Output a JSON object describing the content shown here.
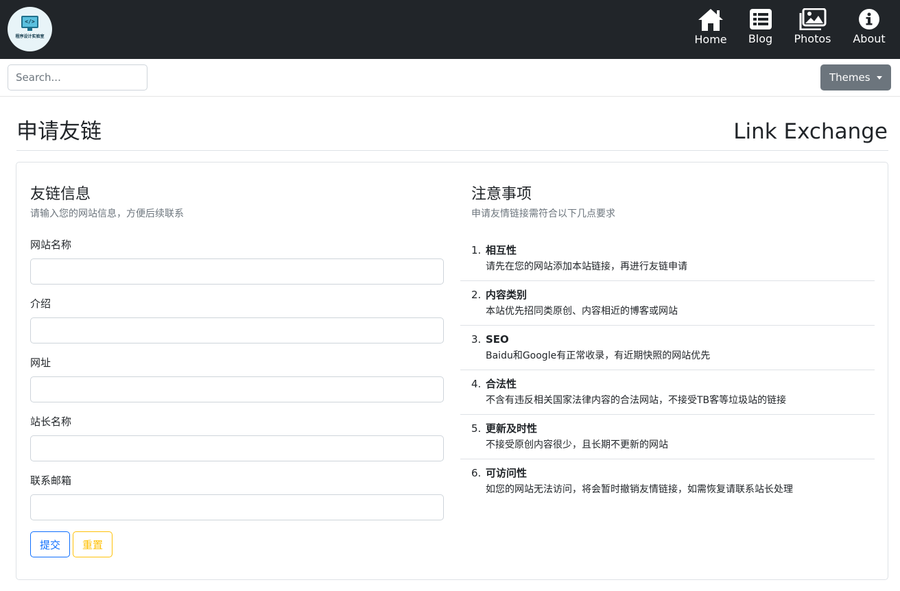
{
  "logo": {
    "code_glyph": "</>",
    "title": "程序设计实验室"
  },
  "nav": {
    "items": [
      {
        "label": "Home",
        "icon": "home-icon"
      },
      {
        "label": "Blog",
        "icon": "list-icon"
      },
      {
        "label": "Photos",
        "icon": "images-icon"
      },
      {
        "label": "About",
        "icon": "info-icon"
      }
    ]
  },
  "search": {
    "placeholder": "Search...",
    "value": ""
  },
  "themes": {
    "label": "Themes"
  },
  "header": {
    "title_cn": "申请友链",
    "title_en": "Link Exchange"
  },
  "form": {
    "title": "友链信息",
    "subtitle": "请输入您的网站信息，方便后续联系",
    "fields": [
      {
        "label": "网站名称",
        "value": ""
      },
      {
        "label": "介绍",
        "value": ""
      },
      {
        "label": "网址",
        "value": ""
      },
      {
        "label": "站长名称",
        "value": ""
      },
      {
        "label": "联系邮箱",
        "value": ""
      }
    ],
    "submit_label": "提交",
    "reset_label": "重置"
  },
  "notes": {
    "title": "注意事项",
    "subtitle": "申请友情链接需符合以下几点要求",
    "items": [
      {
        "num": "1.",
        "heading": "相互性",
        "desc": "请先在您的网站添加本站链接，再进行友链申请"
      },
      {
        "num": "2.",
        "heading": "内容类别",
        "desc": "本站优先招同类原创、内容相近的博客或网站"
      },
      {
        "num": "3.",
        "heading": "SEO",
        "desc": "Baidu和Google有正常收录，有近期快照的网站优先"
      },
      {
        "num": "4.",
        "heading": "合法性",
        "desc": "不含有违反相关国家法律内容的合法网站，不接受TB客等垃圾站的链接"
      },
      {
        "num": "5.",
        "heading": "更新及时性",
        "desc": "不接受原创内容很少，且长期不更新的网站"
      },
      {
        "num": "6.",
        "heading": "可访问性",
        "desc": "如您的网站无法访问，将会暂时撤销友情链接，如需恢复请联系站长处理"
      }
    ]
  },
  "colors": {
    "navbar_bg": "#212529",
    "primary": "#0d6efd",
    "warning": "#ffc107",
    "secondary": "#6c757d"
  }
}
